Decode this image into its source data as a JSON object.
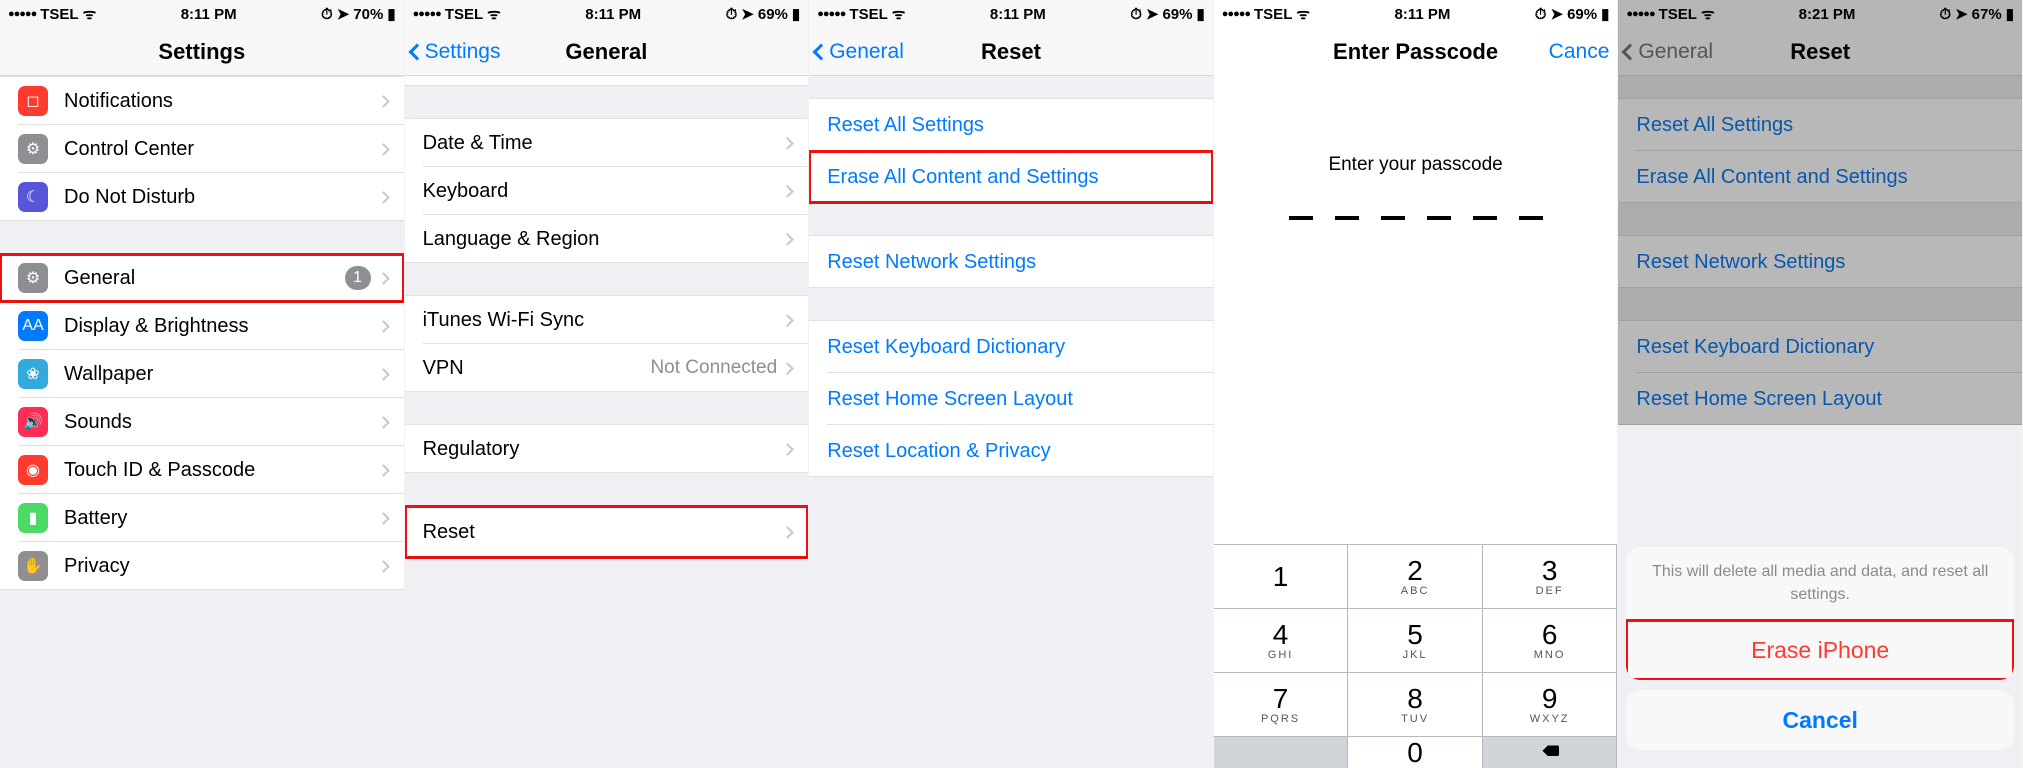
{
  "panels": [
    {
      "status": {
        "carrier": "TSEL",
        "time": "8:11 PM",
        "battery": "70%"
      },
      "nav": {
        "title": "Settings"
      },
      "rows": {
        "notifications": "Notifications",
        "control_center": "Control Center",
        "dnd": "Do Not Disturb",
        "general": "General",
        "general_badge": "1",
        "display": "Display & Brightness",
        "wallpaper": "Wallpaper",
        "sounds": "Sounds",
        "touchid": "Touch ID & Passcode",
        "battery": "Battery",
        "privacy": "Privacy"
      }
    },
    {
      "status": {
        "carrier": "TSEL",
        "time": "8:11 PM",
        "battery": "69%"
      },
      "nav": {
        "back": "Settings",
        "title": "General"
      },
      "rows": {
        "datetime": "Date & Time",
        "keyboard": "Keyboard",
        "language": "Language & Region",
        "itunes": "iTunes Wi-Fi Sync",
        "vpn": "VPN",
        "vpn_value": "Not Connected",
        "regulatory": "Regulatory",
        "reset": "Reset"
      }
    },
    {
      "status": {
        "carrier": "TSEL",
        "time": "8:11 PM",
        "battery": "69%"
      },
      "nav": {
        "back": "General",
        "title": "Reset"
      },
      "rows": {
        "reset_all": "Reset All Settings",
        "erase": "Erase All Content and Settings",
        "network": "Reset Network Settings",
        "keyboard": "Reset Keyboard Dictionary",
        "home": "Reset Home Screen Layout",
        "location": "Reset Location & Privacy"
      }
    },
    {
      "status": {
        "carrier": "TSEL",
        "time": "8:11 PM",
        "battery": "69%"
      },
      "nav": {
        "title": "Enter Passcode",
        "right": "Cance"
      },
      "prompt": "Enter your passcode",
      "keypad": [
        {
          "n": "1",
          "l": ""
        },
        {
          "n": "2",
          "l": "ABC"
        },
        {
          "n": "3",
          "l": "DEF"
        },
        {
          "n": "4",
          "l": "GHI"
        },
        {
          "n": "5",
          "l": "JKL"
        },
        {
          "n": "6",
          "l": "MNO"
        },
        {
          "n": "7",
          "l": "PQRS"
        },
        {
          "n": "8",
          "l": "TUV"
        },
        {
          "n": "9",
          "l": "WXYZ"
        },
        {
          "n": "",
          "l": ""
        },
        {
          "n": "0",
          "l": ""
        },
        {
          "n": "⌫",
          "l": ""
        }
      ]
    },
    {
      "status": {
        "carrier": "TSEL",
        "time": "8:21 PM",
        "battery": "67%"
      },
      "nav": {
        "back": "General",
        "title": "Reset"
      },
      "rows": {
        "reset_all": "Reset All Settings",
        "erase": "Erase All Content and Settings",
        "network": "Reset Network Settings",
        "keyboard": "Reset Keyboard Dictionary",
        "home": "Reset Home Screen Layout"
      },
      "sheet": {
        "message": "This will delete all media and data, and reset all settings.",
        "erase": "Erase iPhone",
        "cancel": "Cancel"
      }
    }
  ]
}
